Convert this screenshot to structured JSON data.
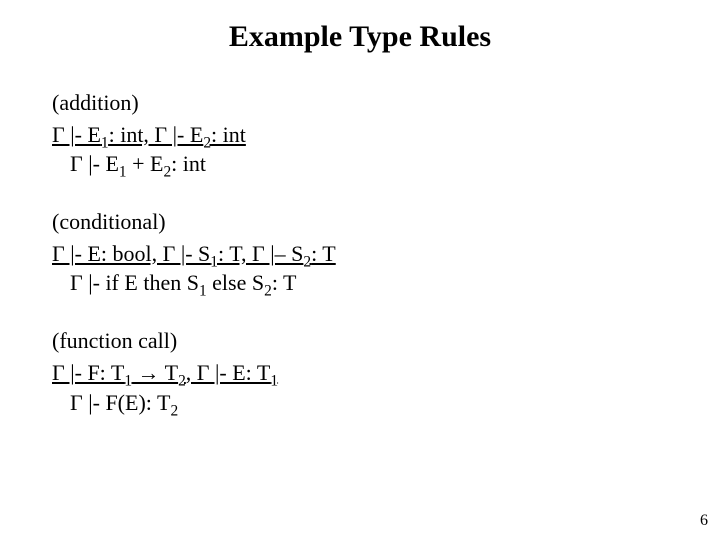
{
  "title": "Example Type Rules",
  "rules": {
    "addition": {
      "name": "(addition)",
      "premise_prefix": "Γ  |- E",
      "premise_s1": "1",
      "premise_mid1": ": int, Γ |- E",
      "premise_s2": "2",
      "premise_suffix": ": int",
      "conclusion_prefix": "Γ |- E",
      "conclusion_s1": "1",
      "conclusion_mid": " + E",
      "conclusion_s2": "2",
      "conclusion_suffix": ": int"
    },
    "conditional": {
      "name": "(conditional)",
      "premise_prefix": "Γ |- E: bool, Γ |- S",
      "premise_s1": "1",
      "premise_mid1": ": T, Γ |– S",
      "premise_s2": "2",
      "premise_suffix": ": T",
      "conclusion_prefix": "Γ |- if E then S",
      "conclusion_s1": "1",
      "conclusion_mid": " else S",
      "conclusion_s2": "2",
      "conclusion_suffix": ": T"
    },
    "fcall": {
      "name": "(function call)",
      "premise_prefix": "Γ |- F: T",
      "premise_s1": "1",
      "premise_mid1": " → T",
      "premise_s2": "2",
      "premise_mid2": ", Γ |- E: T",
      "premise_s3": "1",
      "premise_suffix": "",
      "conclusion_prefix": "Γ |- F(E): T",
      "conclusion_s1": "2",
      "conclusion_suffix": ""
    }
  },
  "page_number": "6"
}
